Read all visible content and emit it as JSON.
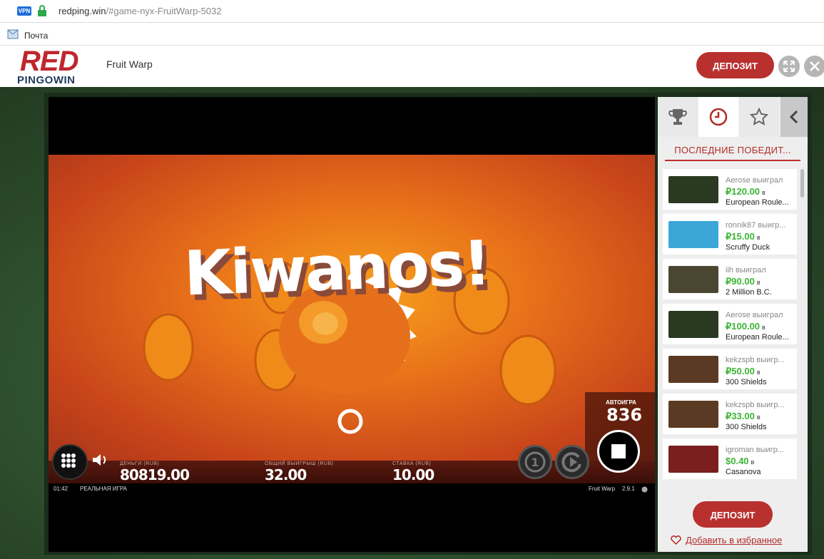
{
  "browser": {
    "vpn_badge": "VPN",
    "url_host": "redping.win",
    "url_path": "/#game-nyx-FruitWarp-5032",
    "bookmark_label": "Почта"
  },
  "site": {
    "logo_top": "RED",
    "logo_bottom": "PINGOWIN",
    "game_title": "Fruit Warp",
    "deposit_label": "ДЕПОЗИТ"
  },
  "game": {
    "headline": "Kiwanos!",
    "money_label": "ДЕНЬГИ (RUB)",
    "money_value": "80819.00",
    "win_label": "ОБЩИЙ ВЫИГРЫШ (RUB)",
    "win_value": "32.00",
    "bet_label": "СТАВКА (RUB)",
    "bet_value": "10.00",
    "autoplay_label": "АВТОИГРА",
    "autoplay_value": "836",
    "time": "01:42",
    "mode": "РЕАЛЬНАЯ ИГРА",
    "game_name": "Fruit Warp",
    "version": "2.9.1"
  },
  "sidebar": {
    "section_title": "ПОСЛЕДНИЕ ПОБЕДИТ...",
    "items": [
      {
        "who": "Aerose выиграл",
        "amount": "₽120.00",
        "in": "в",
        "game": "European Roule...",
        "color": "#2a3a22"
      },
      {
        "who": "ronnik87 выигр...",
        "amount": "₽15.00",
        "in": "в",
        "game": "Scruffy Duck",
        "color": "#3aa7d8"
      },
      {
        "who": "iih выиграл",
        "amount": "₽90.00",
        "in": "в",
        "game": "2 Million B.C.",
        "color": "#4a4632"
      },
      {
        "who": "Aerose выиграл",
        "amount": "₽100.00",
        "in": "в",
        "game": "European Roule...",
        "color": "#2a3a22"
      },
      {
        "who": "kekzspb выигр...",
        "amount": "₽50.00",
        "in": "в",
        "game": "300 Shields",
        "color": "#5a3a22"
      },
      {
        "who": "kekzspb выигр...",
        "amount": "₽33.00",
        "in": "в",
        "game": "300 Shields",
        "color": "#5a3a22"
      },
      {
        "who": "igroman выигр...",
        "amount": "$0.40",
        "in": "в",
        "game": "Casanova",
        "color": "#7a1e1e"
      }
    ],
    "deposit_label": "ДЕПОЗИТ",
    "favorite_label": "Добавить в избранное"
  }
}
